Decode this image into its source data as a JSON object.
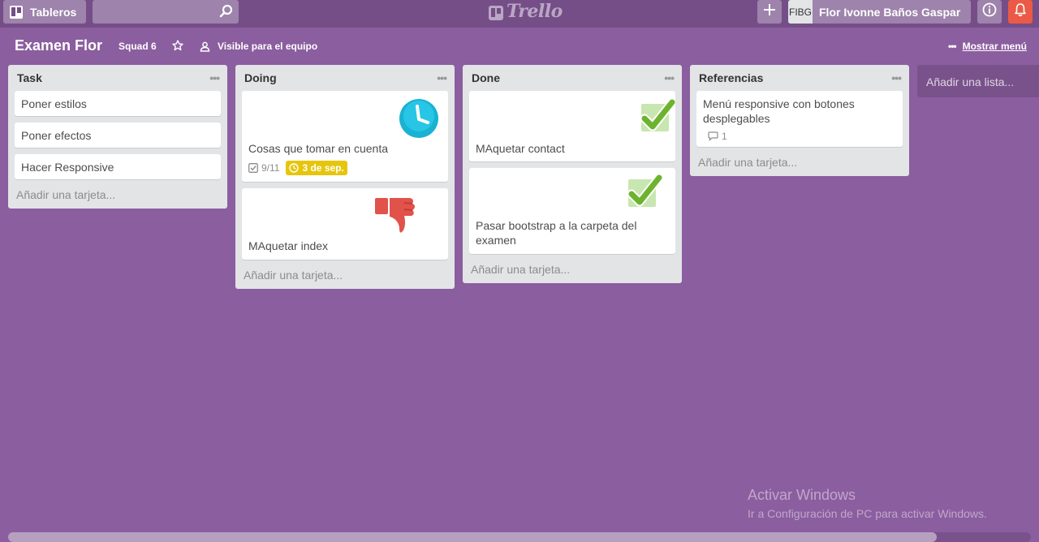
{
  "header": {
    "boards_label": "Tableros",
    "search_placeholder": "",
    "logo_text": "Trello",
    "member_initials": "FIBG",
    "member_name": "Flor Ivonne Baños Gaspar"
  },
  "board": {
    "title": "Examen Flor",
    "team": "Squad 6",
    "visibility": "Visible para el equipo",
    "menu_label": "Mostrar menú"
  },
  "lists": [
    {
      "title": "Task",
      "add_card": "Añadir una tarjeta...",
      "cards": [
        {
          "title": "Poner estilos"
        },
        {
          "title": "Poner efectos"
        },
        {
          "title": "Hacer Responsive"
        }
      ]
    },
    {
      "title": "Doing",
      "add_card": "Añadir una tarjeta...",
      "cards": [
        {
          "title": "Cosas que tomar en cuenta",
          "sticker": "clock-sticker",
          "checklist": "9/11",
          "due": "3 de sep."
        },
        {
          "title": "MAquetar index",
          "sticker": "thumbs-down-sticker"
        }
      ]
    },
    {
      "title": "Done",
      "add_card": "Añadir una tarjeta...",
      "cards": [
        {
          "title": "MAquetar contact",
          "sticker": "check-sticker"
        },
        {
          "title": "Pasar bootstrap a la carpeta del examen",
          "sticker": "check-sticker"
        }
      ]
    },
    {
      "title": "Referencias",
      "add_card": "Añadir una tarjeta...",
      "cards": [
        {
          "title": "Menú responsive con botones desplegables",
          "comments": "1"
        }
      ]
    }
  ],
  "add_list": "Añadir una lista...",
  "watermark": {
    "line1": "Activar Windows",
    "line2": "Ir a Configuración de PC para activar Windows."
  },
  "colors": {
    "board_bg": "#8b5e9f",
    "header_bg": "#754e88",
    "due_badge": "#e6c60d",
    "notification": "#eb5a46"
  }
}
